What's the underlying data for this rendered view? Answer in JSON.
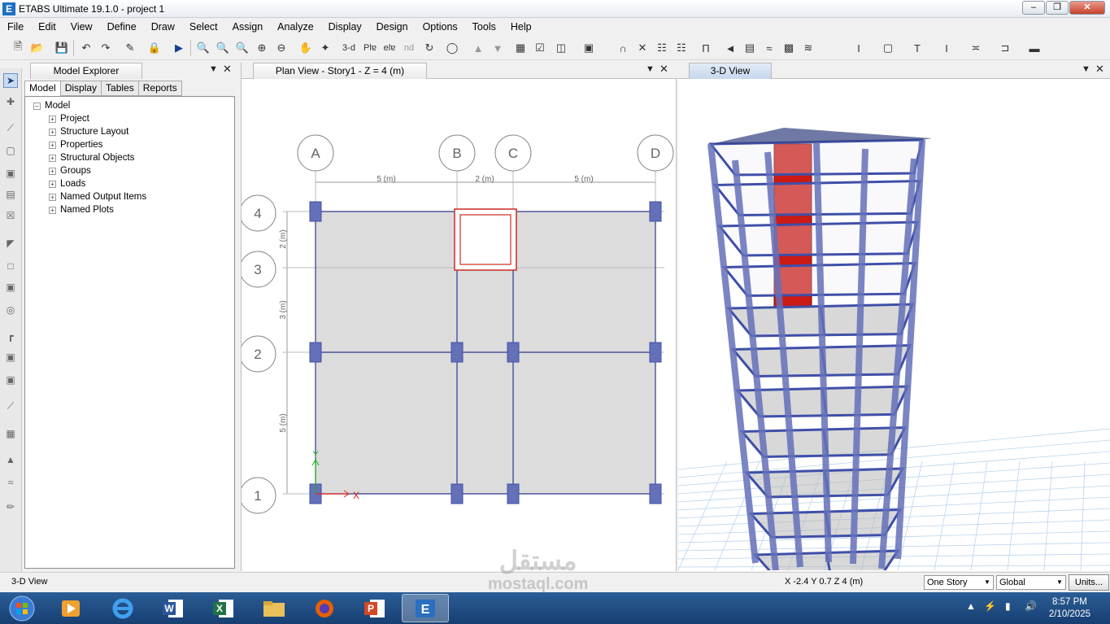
{
  "window": {
    "title": "ETABS Ultimate 19.1.0 - project 1",
    "icon_letter": "E"
  },
  "menu": [
    "File",
    "Edit",
    "View",
    "Define",
    "Draw",
    "Select",
    "Assign",
    "Analyze",
    "Display",
    "Design",
    "Options",
    "Tools",
    "Help"
  ],
  "toolbar": {
    "view_3d_label": "3-d",
    "plan_label": "Plɐ",
    "elev_label": "elɐ",
    "nd_label": "nd"
  },
  "explorer": {
    "title": "Model Explorer",
    "tabs": [
      "Model",
      "Display",
      "Tables",
      "Reports"
    ],
    "root": "Model",
    "items": [
      "Project",
      "Structure Layout",
      "Properties",
      "Structural Objects",
      "Groups",
      "Loads",
      "Named Output Items",
      "Named Plots"
    ]
  },
  "plan_view": {
    "title": "Plan View - Story1 - Z = 4 (m)",
    "grid_columns": [
      "A",
      "B",
      "C",
      "D"
    ],
    "grid_rows": [
      "4",
      "3",
      "2",
      "1"
    ],
    "spacing_x": [
      "5 (m)",
      "2 (m)",
      "5 (m)"
    ],
    "spacing_y": [
      "2 (m)",
      "3 (m)",
      "5 (m)"
    ],
    "axis_x": "X",
    "axis_y": "Y"
  },
  "view_3d": {
    "title": "3-D View"
  },
  "status": {
    "left": "3-D View",
    "coords": "X -2.4  Y 0.7  Z 4 (m)",
    "story_select": "One Story",
    "coord_select": "Global",
    "units_button": "Units..."
  },
  "taskbar": {
    "time": "8:57 PM",
    "date": "2/10/2025"
  },
  "watermark": {
    "arabic": "مستقل",
    "latin": "mostaql.com"
  },
  "colors": {
    "beam": "#3f4fa8",
    "column": "#6470b8",
    "wall": "#cc1a14",
    "slab": "#dcdcdc",
    "grid_line": "#2d3a8c"
  }
}
